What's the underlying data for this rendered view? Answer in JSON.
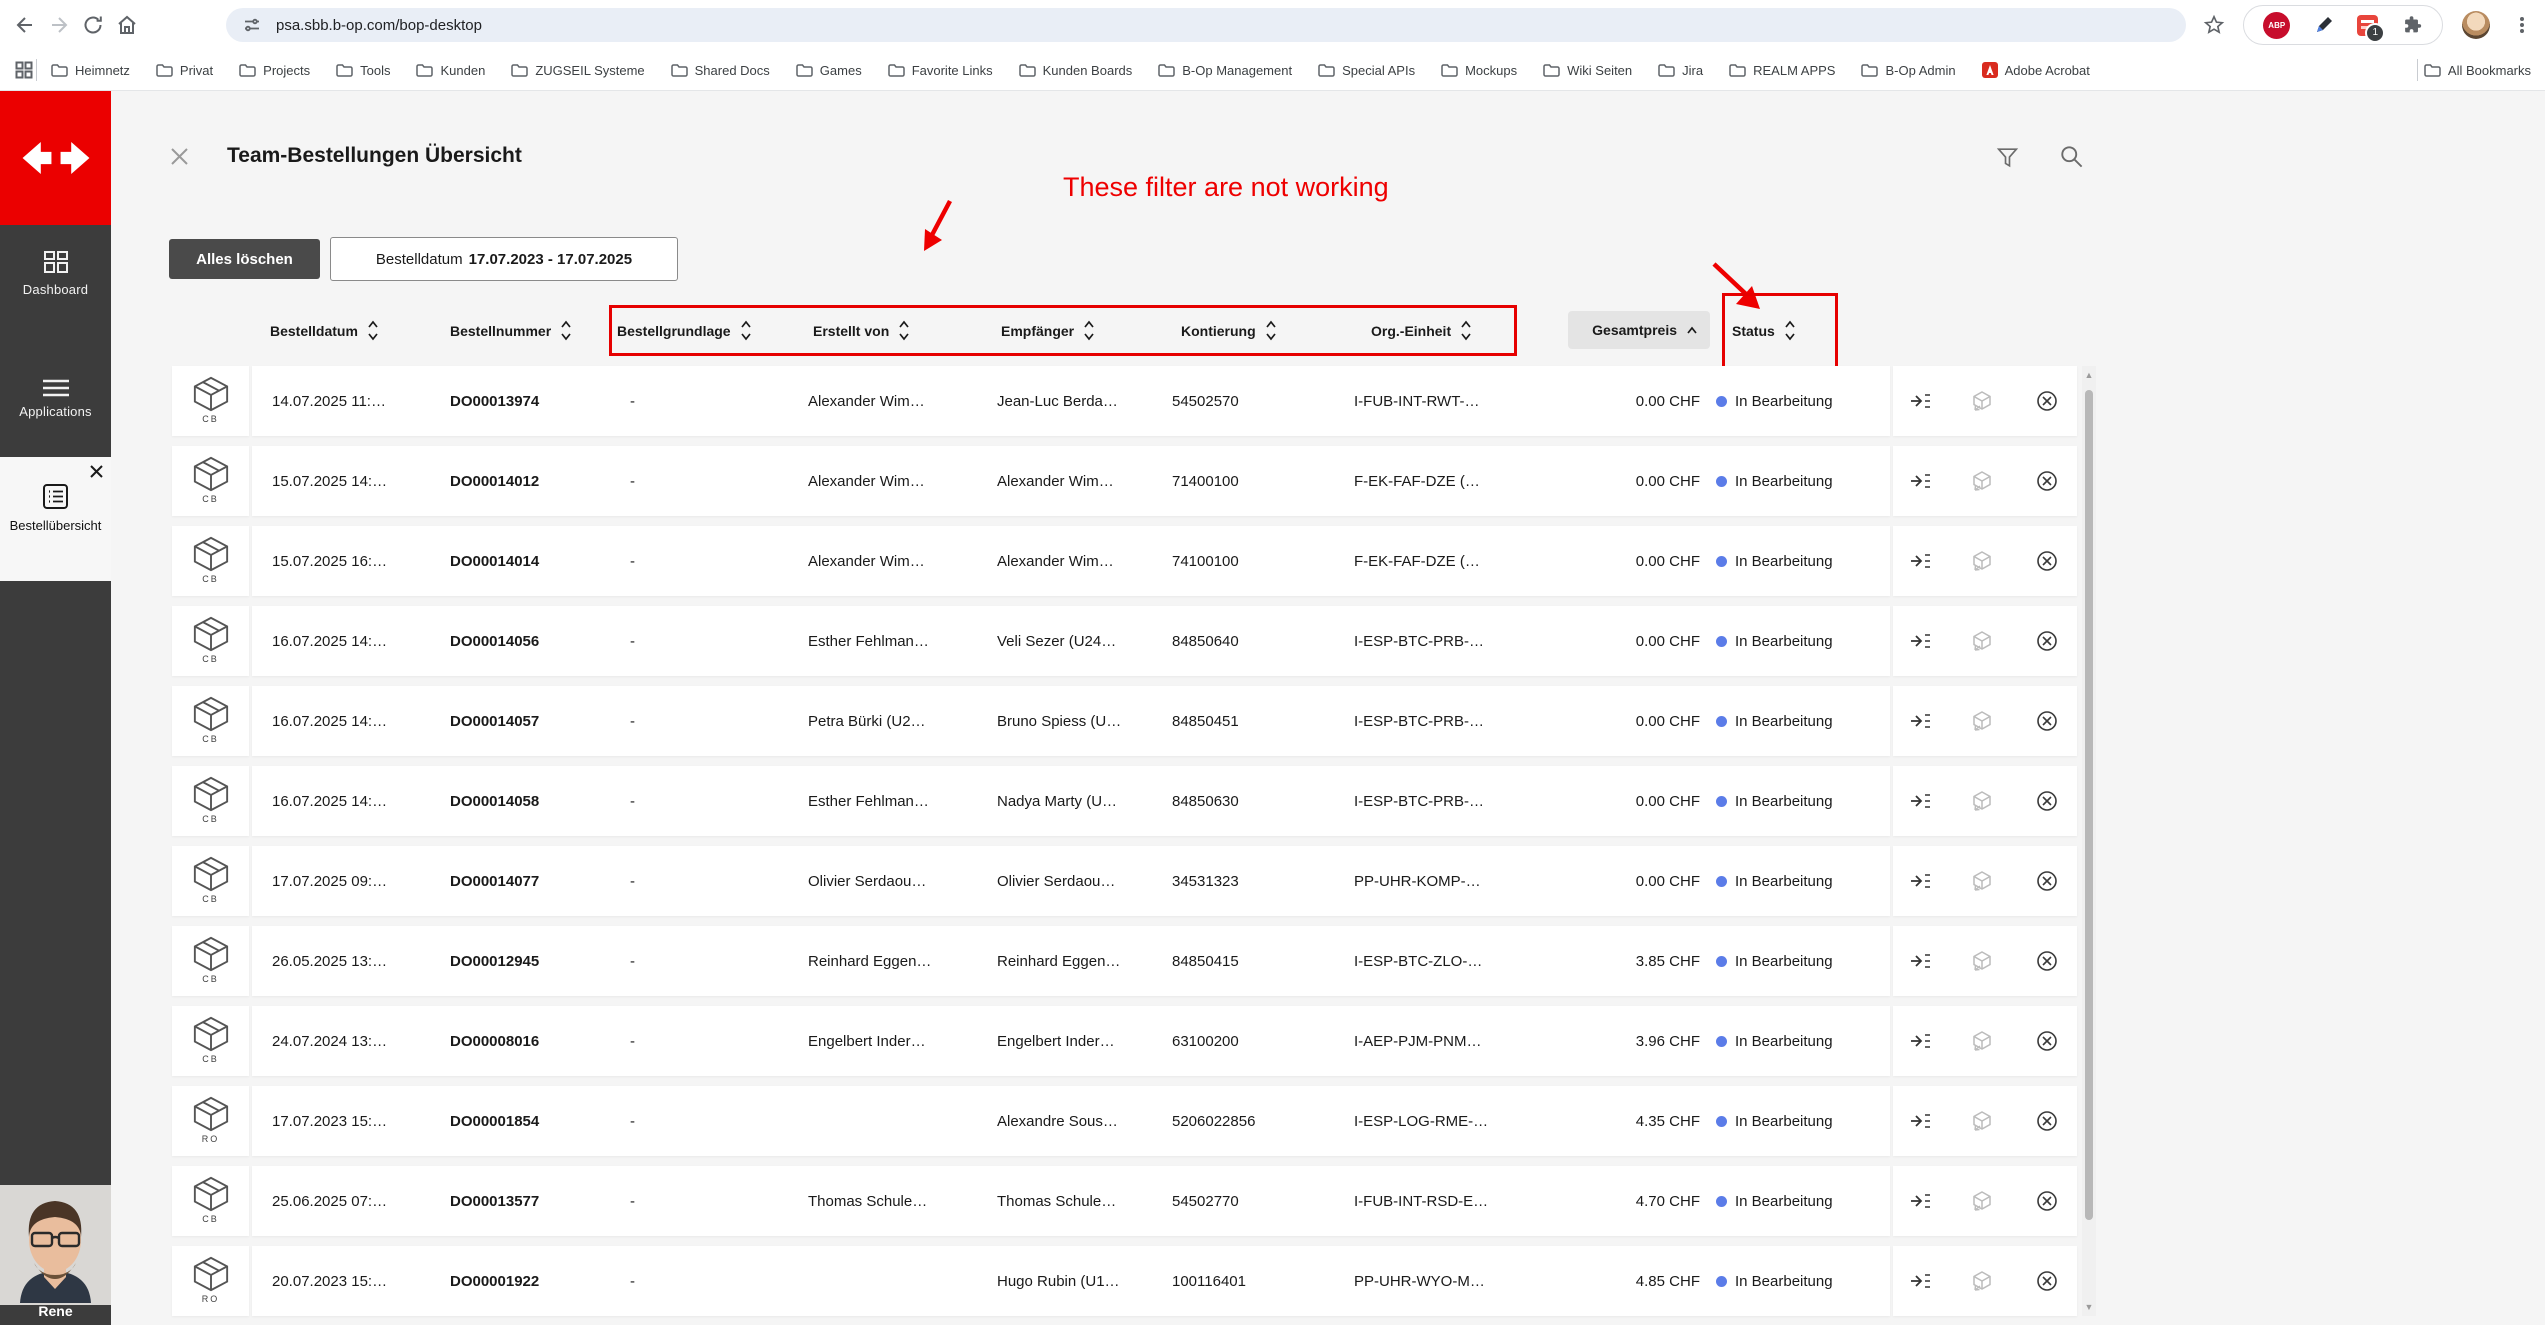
{
  "browser": {
    "url": "psa.sbb.b-op.com/bop-desktop",
    "extension_badge": "1",
    "abp_label": "ABP",
    "bookmarks": [
      {
        "label": "Heimnetz",
        "icon": "folder"
      },
      {
        "label": "Privat",
        "icon": "folder"
      },
      {
        "label": "Projects",
        "icon": "folder"
      },
      {
        "label": "Tools",
        "icon": "folder"
      },
      {
        "label": "Kunden",
        "icon": "folder"
      },
      {
        "label": "ZUGSEIL Systeme",
        "icon": "folder"
      },
      {
        "label": "Shared Docs",
        "icon": "folder"
      },
      {
        "label": "Games",
        "icon": "folder"
      },
      {
        "label": "Favorite Links",
        "icon": "folder"
      },
      {
        "label": "Kunden Boards",
        "icon": "folder"
      },
      {
        "label": "B-Op Management",
        "icon": "folder"
      },
      {
        "label": "Special APIs",
        "icon": "folder"
      },
      {
        "label": "Mockups",
        "icon": "folder"
      },
      {
        "label": "Wiki Seiten",
        "icon": "folder"
      },
      {
        "label": "Jira",
        "icon": "folder"
      },
      {
        "label": "REALM APPS",
        "icon": "folder"
      },
      {
        "label": "B-Op Admin",
        "icon": "folder"
      },
      {
        "label": "Adobe Acrobat",
        "icon": "adobe"
      }
    ],
    "all_bookmarks_label": "All Bookmarks"
  },
  "sidebar": {
    "brand_color": "#eb0000",
    "items": [
      {
        "label": "Dashboard"
      },
      {
        "label": "Applications"
      },
      {
        "label": "Bestellübersicht",
        "active": true
      }
    ],
    "user_name": "Rene"
  },
  "header": {
    "title": "Team-Bestellungen Übersicht"
  },
  "filters": {
    "clear_all_label": "Alles löschen",
    "date_chip_label": "Bestelldatum",
    "date_chip_value": "17.07.2023 - 17.07.2025"
  },
  "annotation": {
    "text": "These filter are not working",
    "color": "#ee0000"
  },
  "table": {
    "columns": [
      "Bestelldatum",
      "Bestellnummer",
      "Bestellgrundlage",
      "Erstellt von",
      "Empfänger",
      "Kontierung",
      "Org.-Einheit",
      "Gesamtpreis",
      "Status"
    ],
    "sorted_column": "Gesamtpreis",
    "status_dot_color": "#5b7ce8",
    "rows": [
      {
        "type": "CB",
        "date": "14.07.2025 11:…",
        "number": "DO00013974",
        "basis": "-",
        "created_by": "Alexander Wim…",
        "recipient": "Jean-Luc Berda…",
        "account": "54502570",
        "org_unit": "I-FUB-INT-RWT-…",
        "total": "0.00 CHF",
        "status": "In Bearbeitung"
      },
      {
        "type": "CB",
        "date": "15.07.2025 14:…",
        "number": "DO00014012",
        "basis": "-",
        "created_by": "Alexander Wim…",
        "recipient": "Alexander Wim…",
        "account": "71400100",
        "org_unit": "F-EK-FAF-DZE (…",
        "total": "0.00 CHF",
        "status": "In Bearbeitung"
      },
      {
        "type": "CB",
        "date": "15.07.2025 16:…",
        "number": "DO00014014",
        "basis": "-",
        "created_by": "Alexander Wim…",
        "recipient": "Alexander Wim…",
        "account": "74100100",
        "org_unit": "F-EK-FAF-DZE (…",
        "total": "0.00 CHF",
        "status": "In Bearbeitung"
      },
      {
        "type": "CB",
        "date": "16.07.2025 14:…",
        "number": "DO00014056",
        "basis": "-",
        "created_by": "Esther Fehlman…",
        "recipient": "Veli Sezer (U24…",
        "account": "84850640",
        "org_unit": "I-ESP-BTC-PRB-…",
        "total": "0.00 CHF",
        "status": "In Bearbeitung"
      },
      {
        "type": "CB",
        "date": "16.07.2025 14:…",
        "number": "DO00014057",
        "basis": "-",
        "created_by": "Petra Bürki (U2…",
        "recipient": "Bruno Spiess (U…",
        "account": "84850451",
        "org_unit": "I-ESP-BTC-PRB-…",
        "total": "0.00 CHF",
        "status": "In Bearbeitung"
      },
      {
        "type": "CB",
        "date": "16.07.2025 14:…",
        "number": "DO00014058",
        "basis": "-",
        "created_by": "Esther Fehlman…",
        "recipient": "Nadya Marty (U…",
        "account": "84850630",
        "org_unit": "I-ESP-BTC-PRB-…",
        "total": "0.00 CHF",
        "status": "In Bearbeitung"
      },
      {
        "type": "CB",
        "date": "17.07.2025 09:…",
        "number": "DO00014077",
        "basis": "-",
        "created_by": "Olivier Serdaou…",
        "recipient": "Olivier Serdaou…",
        "account": "34531323",
        "org_unit": "PP-UHR-KOMP-…",
        "total": "0.00 CHF",
        "status": "In Bearbeitung"
      },
      {
        "type": "CB",
        "date": "26.05.2025 13:…",
        "number": "DO00012945",
        "basis": "-",
        "created_by": "Reinhard Eggen…",
        "recipient": "Reinhard Eggen…",
        "account": "84850415",
        "org_unit": "I-ESP-BTC-ZLO-…",
        "total": "3.85 CHF",
        "status": "In Bearbeitung"
      },
      {
        "type": "CB",
        "date": "24.07.2024 13:…",
        "number": "DO00008016",
        "basis": "-",
        "created_by": "Engelbert Inder…",
        "recipient": "Engelbert Inder…",
        "account": "63100200",
        "org_unit": "I-AEP-PJM-PNM…",
        "total": "3.96 CHF",
        "status": "In Bearbeitung"
      },
      {
        "type": "RO",
        "date": "17.07.2023 15:…",
        "number": "DO00001854",
        "basis": "-",
        "created_by": "",
        "recipient": "Alexandre Sous…",
        "account": "5206022856",
        "org_unit": "I-ESP-LOG-RME-…",
        "total": "4.35 CHF",
        "status": "In Bearbeitung"
      },
      {
        "type": "CB",
        "date": "25.06.2025 07:…",
        "number": "DO00013577",
        "basis": "-",
        "created_by": "Thomas Schule…",
        "recipient": "Thomas Schule…",
        "account": "54502770",
        "org_unit": "I-FUB-INT-RSD-E…",
        "total": "4.70 CHF",
        "status": "In Bearbeitung"
      },
      {
        "type": "RO",
        "date": "20.07.2023 15:…",
        "number": "DO00001922",
        "basis": "-",
        "created_by": "",
        "recipient": "Hugo Rubin (U1…",
        "account": "100116401",
        "org_unit": "PP-UHR-WYO-M…",
        "total": "4.85 CHF",
        "status": "In Bearbeitung"
      }
    ]
  }
}
